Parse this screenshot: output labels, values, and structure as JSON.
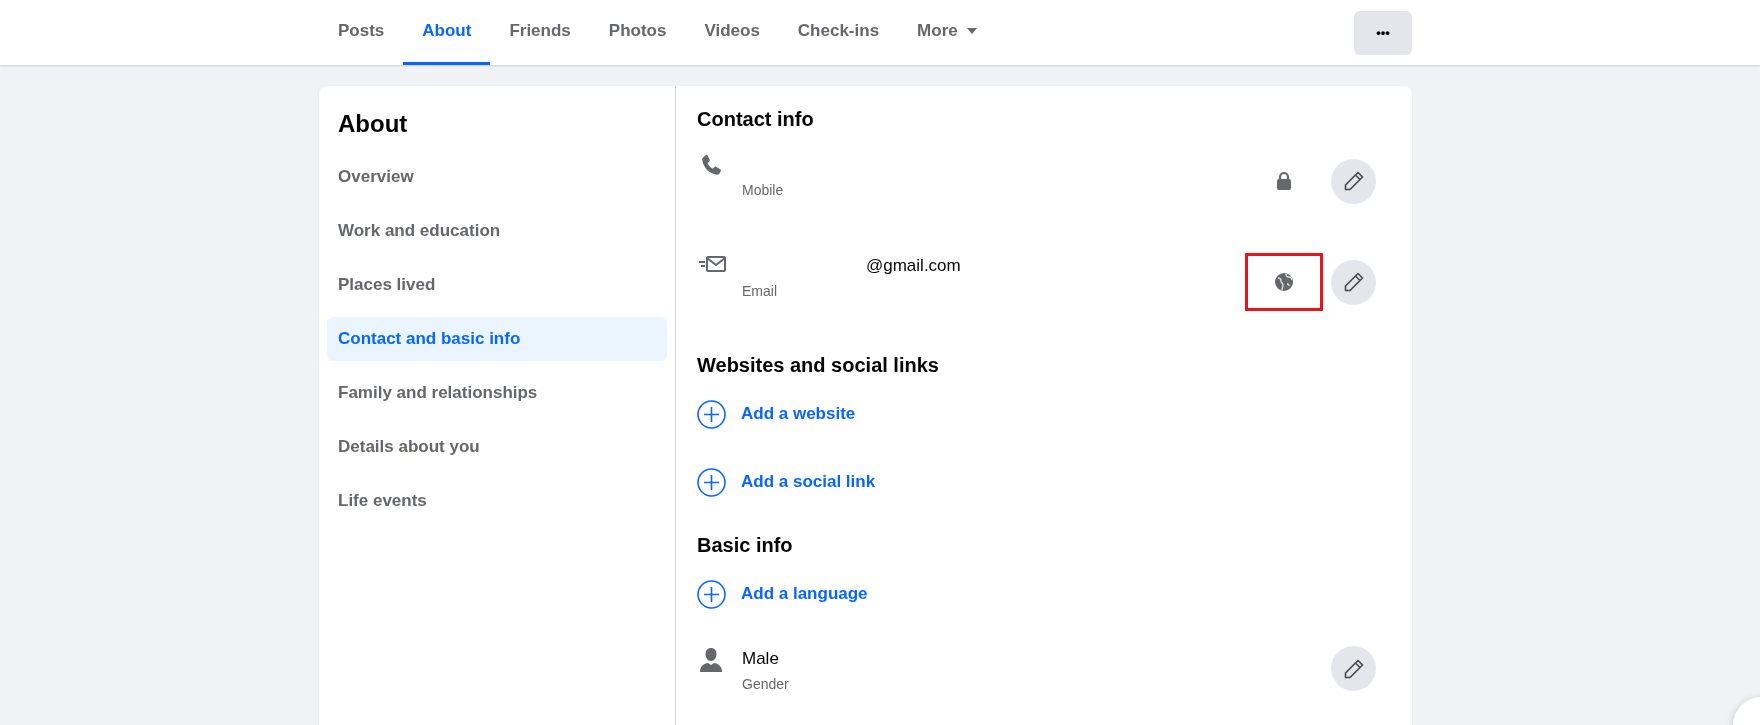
{
  "tabs": [
    {
      "label": "Posts",
      "selected": false
    },
    {
      "label": "About",
      "selected": true
    },
    {
      "label": "Friends",
      "selected": false
    },
    {
      "label": "Photos",
      "selected": false
    },
    {
      "label": "Videos",
      "selected": false
    },
    {
      "label": "Check-ins",
      "selected": false
    },
    {
      "label": "More",
      "selected": false,
      "dropdown": true
    }
  ],
  "more_button": {
    "label": "•••"
  },
  "sidebar": {
    "title": "About",
    "items": [
      {
        "label": "Overview",
        "selected": false
      },
      {
        "label": "Work and education",
        "selected": false
      },
      {
        "label": "Places lived",
        "selected": false
      },
      {
        "label": "Contact and basic info",
        "selected": true
      },
      {
        "label": "Family and relationships",
        "selected": false
      },
      {
        "label": "Details about you",
        "selected": false
      },
      {
        "label": "Life events",
        "selected": false
      }
    ]
  },
  "sections": [
    {
      "heading": "Contact info",
      "entries": [
        {
          "kind": "phone",
          "label": "Mobile",
          "private": true,
          "highlighted": false
        },
        {
          "kind": "email",
          "value": "@gmail.com",
          "label": "Email",
          "private": false,
          "highlighted": true
        }
      ]
    },
    {
      "heading": "Websites and social links",
      "entries": [
        {
          "kind": "add",
          "label": "Add a website"
        },
        {
          "kind": "add",
          "label": "Add a social link"
        }
      ]
    },
    {
      "heading": "Basic info",
      "entries": [
        {
          "kind": "add",
          "label": "Add a language"
        },
        {
          "kind": "person",
          "value": "Male",
          "label": "Gender"
        }
      ]
    }
  ]
}
